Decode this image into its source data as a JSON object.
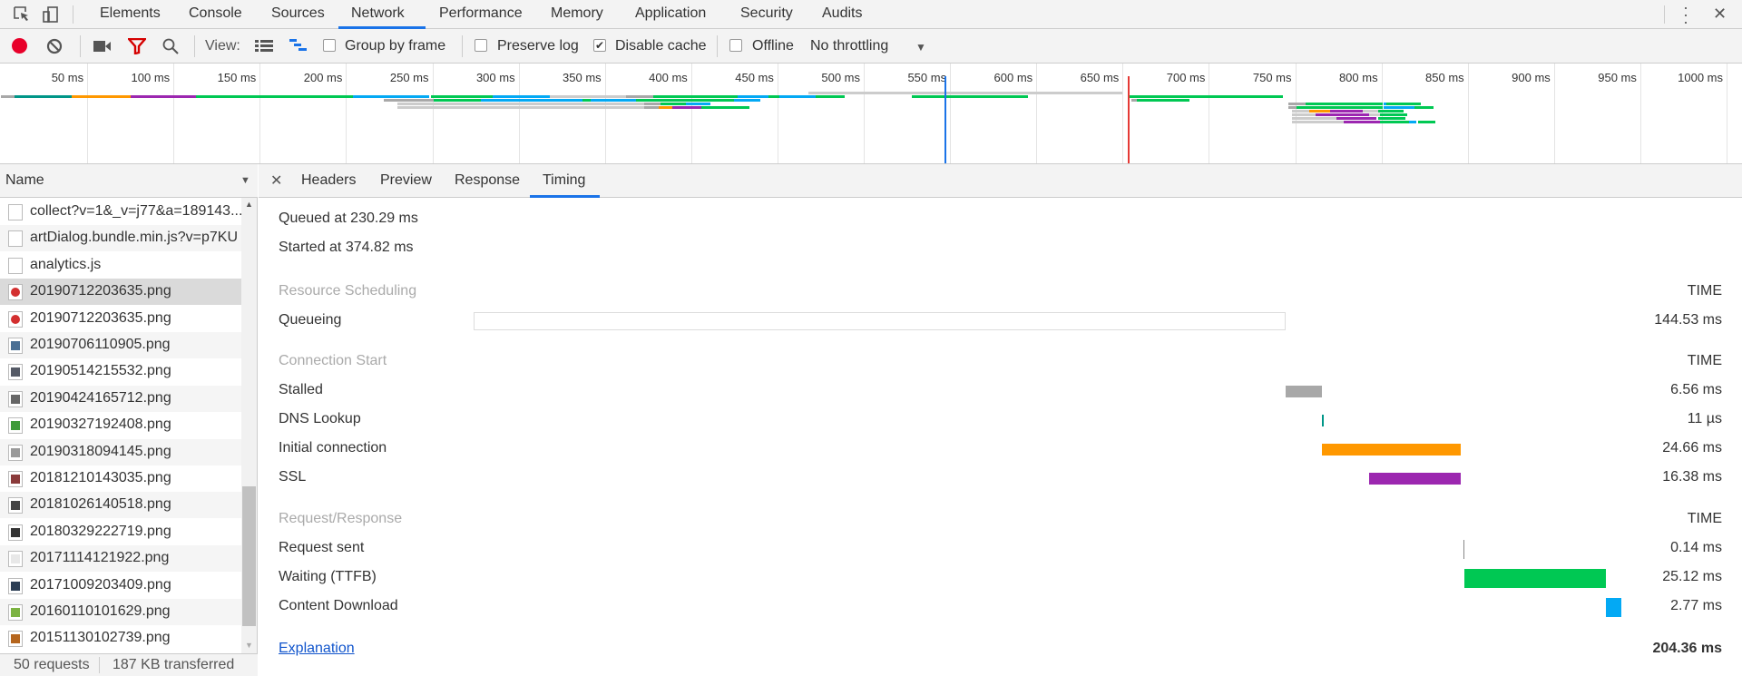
{
  "tabbar": {
    "tabs": [
      "Elements",
      "Console",
      "Sources",
      "Network",
      "Performance",
      "Memory",
      "Application",
      "Security",
      "Audits"
    ],
    "active": "Network"
  },
  "toolbar": {
    "view_label": "View:",
    "group_by_frame": "Group by frame",
    "group_by_frame_checked": false,
    "preserve_log": "Preserve log",
    "preserve_log_checked": false,
    "disable_cache": "Disable cache",
    "disable_cache_checked": true,
    "offline": "Offline",
    "offline_checked": false,
    "throttling": "No throttling"
  },
  "overview": {
    "ticks": [
      "50 ms",
      "100 ms",
      "150 ms",
      "200 ms",
      "250 ms",
      "300 ms",
      "350 ms",
      "400 ms",
      "450 ms",
      "500 ms",
      "550 ms",
      "600 ms",
      "650 ms",
      "700 ms",
      "750 ms",
      "800 ms",
      "850 ms",
      "900 ms",
      "950 ms",
      "1000 ms"
    ],
    "dom_content_loaded_ms": 547,
    "load_ms": 653,
    "colors": {
      "queued": "#cccccc",
      "stalled": "#a8a8a8",
      "dns": "#009688",
      "connect": "#ff9800",
      "ssl": "#9c27b0",
      "waiting": "#00c853",
      "download": "#03a9f4",
      "dcl": "#1a73e8",
      "load": "#e53935"
    },
    "segments": [
      [
        0,
        468,
        650,
        "queued"
      ],
      [
        1,
        0,
        8,
        "stalled"
      ],
      [
        1,
        8,
        41,
        "dns"
      ],
      [
        1,
        41,
        75,
        "connect"
      ],
      [
        1,
        75,
        113,
        "ssl"
      ],
      [
        1,
        113,
        204,
        "waiting"
      ],
      [
        1,
        204,
        248,
        "download"
      ],
      [
        1,
        249,
        285,
        "waiting"
      ],
      [
        1,
        285,
        318,
        "download"
      ],
      [
        1,
        318,
        362,
        "queued"
      ],
      [
        1,
        362,
        378,
        "stalled"
      ],
      [
        1,
        378,
        427,
        "waiting"
      ],
      [
        1,
        427,
        445,
        "download"
      ],
      [
        1,
        445,
        451,
        "waiting"
      ],
      [
        1,
        451,
        472,
        "download"
      ],
      [
        1,
        472,
        489,
        "waiting"
      ],
      [
        1,
        528,
        595,
        "waiting"
      ],
      [
        1,
        653,
        743,
        "waiting"
      ],
      [
        2,
        222,
        251,
        "stalled"
      ],
      [
        2,
        251,
        278,
        "waiting"
      ],
      [
        2,
        278,
        337,
        "download"
      ],
      [
        2,
        337,
        342,
        "waiting"
      ],
      [
        2,
        342,
        368,
        "download"
      ],
      [
        2,
        368,
        425,
        "waiting"
      ],
      [
        2,
        425,
        440,
        "download"
      ],
      [
        2,
        655,
        658,
        "stalled"
      ],
      [
        2,
        658,
        689,
        "waiting"
      ],
      [
        3,
        230,
        373,
        "queued"
      ],
      [
        3,
        373,
        382,
        "stalled"
      ],
      [
        3,
        382,
        397,
        "waiting"
      ],
      [
        3,
        397,
        411,
        "download"
      ],
      [
        3,
        746,
        756,
        "stalled"
      ],
      [
        3,
        756,
        801,
        "waiting"
      ],
      [
        3,
        801,
        803,
        "download"
      ],
      [
        3,
        803,
        823,
        "waiting"
      ],
      [
        4,
        230,
        373,
        "queued"
      ],
      [
        4,
        373,
        381,
        "stalled"
      ],
      [
        4,
        381,
        389,
        "connect"
      ],
      [
        4,
        389,
        406,
        "ssl"
      ],
      [
        4,
        406,
        434,
        "waiting"
      ],
      [
        4,
        746,
        751,
        "stalled"
      ],
      [
        4,
        751,
        801,
        "waiting"
      ],
      [
        4,
        801,
        819,
        "download"
      ],
      [
        4,
        819,
        830,
        "waiting"
      ],
      [
        5,
        748,
        758,
        "queued"
      ],
      [
        5,
        758,
        770,
        "connect"
      ],
      [
        5,
        770,
        789,
        "ssl"
      ],
      [
        5,
        789,
        798,
        "queued"
      ],
      [
        5,
        798,
        813,
        "waiting"
      ],
      [
        6,
        748,
        762,
        "queued"
      ],
      [
        6,
        762,
        793,
        "ssl"
      ],
      [
        6,
        793,
        799,
        "queued"
      ],
      [
        6,
        799,
        815,
        "waiting"
      ],
      [
        7,
        748,
        774,
        "queued"
      ],
      [
        7,
        774,
        797,
        "ssl"
      ],
      [
        7,
        798,
        814,
        "waiting"
      ],
      [
        8,
        748,
        778,
        "queued"
      ],
      [
        8,
        778,
        799,
        "ssl"
      ],
      [
        8,
        799,
        816,
        "waiting"
      ],
      [
        8,
        816,
        820,
        "download"
      ],
      [
        8,
        821,
        831,
        "waiting"
      ]
    ]
  },
  "requests": {
    "column": "Name",
    "items": [
      {
        "name": "collect?v=1&_v=j77&a=189143...",
        "icon": "blank",
        "color": "#ffffff"
      },
      {
        "name": "artDialog.bundle.min.js?v=p7KU",
        "icon": "script",
        "color": "#eeeeee"
      },
      {
        "name": "analytics.js",
        "icon": "script",
        "color": "#eeeeee"
      },
      {
        "name": "20190712203635.png",
        "icon": "image",
        "color": "#d32f2f",
        "selected": true
      },
      {
        "name": "20190712203635.png",
        "icon": "image",
        "color": "#d32f2f"
      },
      {
        "name": "20190706110905.png",
        "icon": "image",
        "color": "#4a6f94"
      },
      {
        "name": "20190514215532.png",
        "icon": "image",
        "color": "#555a66"
      },
      {
        "name": "20190424165712.png",
        "icon": "image",
        "color": "#666666"
      },
      {
        "name": "20190327192408.png",
        "icon": "image",
        "color": "#3f9a3a"
      },
      {
        "name": "20190318094145.png",
        "icon": "image",
        "color": "#9a9a9a"
      },
      {
        "name": "20181210143035.png",
        "icon": "image",
        "color": "#8a3a3a"
      },
      {
        "name": "20181026140518.png",
        "icon": "image",
        "color": "#444444"
      },
      {
        "name": "20180329222719.png",
        "icon": "image",
        "color": "#333333"
      },
      {
        "name": "20171114121922.png",
        "icon": "image",
        "color": "#e8e8e8"
      },
      {
        "name": "20171009203409.png",
        "icon": "image",
        "color": "#2c3e55"
      },
      {
        "name": "20160110101629.png",
        "icon": "image",
        "color": "#7cb342"
      },
      {
        "name": "20151130102739.png",
        "icon": "image",
        "color": "#b5651d"
      }
    ],
    "footer": {
      "requests": "50 requests",
      "transferred": "187 KB transferred"
    }
  },
  "details": {
    "tabs": [
      "Headers",
      "Preview",
      "Response",
      "Timing"
    ],
    "active": "Timing",
    "queued_at": "Queued at 230.29 ms",
    "started_at": "Started at 374.82 ms",
    "time_header": "TIME",
    "sections": [
      {
        "title": "Resource Scheduling",
        "rows": [
          {
            "label": "Queueing",
            "value": "144.53 ms",
            "start_ms": 0,
            "dur_ms": 144.53,
            "kind": "queueing"
          }
        ]
      },
      {
        "title": "Connection Start",
        "rows": [
          {
            "label": "Stalled",
            "value": "6.56 ms",
            "start_ms": 144.53,
            "dur_ms": 6.56,
            "kind": "stalled"
          },
          {
            "label": "DNS Lookup",
            "value": "11 µs",
            "start_ms": 151.09,
            "dur_ms": 0.011,
            "kind": "dns"
          },
          {
            "label": "Initial connection",
            "value": "24.66 ms",
            "start_ms": 151.1,
            "dur_ms": 24.66,
            "kind": "connect"
          },
          {
            "label": "SSL",
            "value": "16.38 ms",
            "start_ms": 159.38,
            "dur_ms": 16.38,
            "kind": "ssl"
          }
        ]
      },
      {
        "title": "Request/Response",
        "rows": [
          {
            "label": "Request sent",
            "value": "0.14 ms",
            "start_ms": 176.33,
            "dur_ms": 0.14,
            "kind": "sent"
          },
          {
            "label": "Waiting (TTFB)",
            "value": "25.12 ms",
            "start_ms": 176.47,
            "dur_ms": 25.12,
            "kind": "waiting"
          },
          {
            "label": "Content Download",
            "value": "2.77 ms",
            "start_ms": 201.59,
            "dur_ms": 2.77,
            "kind": "download"
          }
        ]
      }
    ],
    "explanation": "Explanation",
    "total": "204.36 ms",
    "total_ms": 204.36
  }
}
